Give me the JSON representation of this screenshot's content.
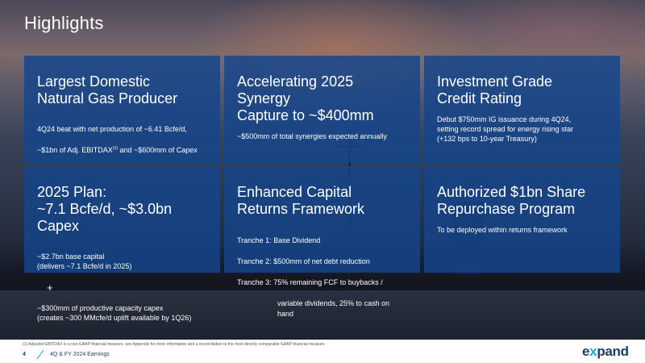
{
  "slide": {
    "title": "Highlights"
  },
  "cards": [
    {
      "heading": "Largest Domestic\nNatural Gas Producer",
      "body_a": "4Q24 beat with net production of ~6.41 Bcfe/d,",
      "body_b_pre": "~$1bn of Adj. EBITDAX",
      "body_b_sup": "(1)",
      "body_b_post": " and ~$600mm of Capex"
    },
    {
      "heading": "Accelerating 2025 Synergy\nCapture to ~$400mm",
      "body": "~$500mm of total synergies expected annually"
    },
    {
      "heading": "Investment Grade\nCredit Rating",
      "body": "Debut $750mm IG issuance during 4Q24,\nsetting record spread for energy rising star\n(+132 bps to 10-year Treasury)"
    },
    {
      "heading": "2025 Plan:\n~7.1 Bcfe/d, ~$3.0bn Capex",
      "body_top": "~$2.7bn base capital\n(delivers ~7.1 Bcfe/d in 2025)",
      "plus": "+",
      "body_bottom": "~$300mm of productive capacity capex\n(creates ~300 MMcfe/d uplift available by 1Q26)"
    },
    {
      "heading": "Enhanced Capital\nReturns Framework",
      "tranche1": "Tranche 1: Base Dividend",
      "tranche2": "Tranche 2: $500mm of net debt reduction",
      "tranche3": "Tranche 3: 75% remaining FCF to buybacks /",
      "tranche3_cont": "variable dividends, 25% to cash on hand"
    },
    {
      "heading": "Authorized $1bn Share\nRepurchase Program",
      "body": "To be deployed within returns framework"
    }
  ],
  "footnote": "(1)   Adjusted EBITDAX is a non-GAAP financial measure, see Appendix for more information and a reconciliation to the most directly comparable GAAP financial measure",
  "footer": {
    "page_number": "4",
    "text": "4Q & FY 2024 Earnings"
  },
  "logo": {
    "part1": "e",
    "part2": "x",
    "part3": "pand"
  },
  "colors": {
    "card_bg": "#14468c",
    "brand_navy": "#1b3c70",
    "brand_cyan": "#1ea6d6"
  }
}
